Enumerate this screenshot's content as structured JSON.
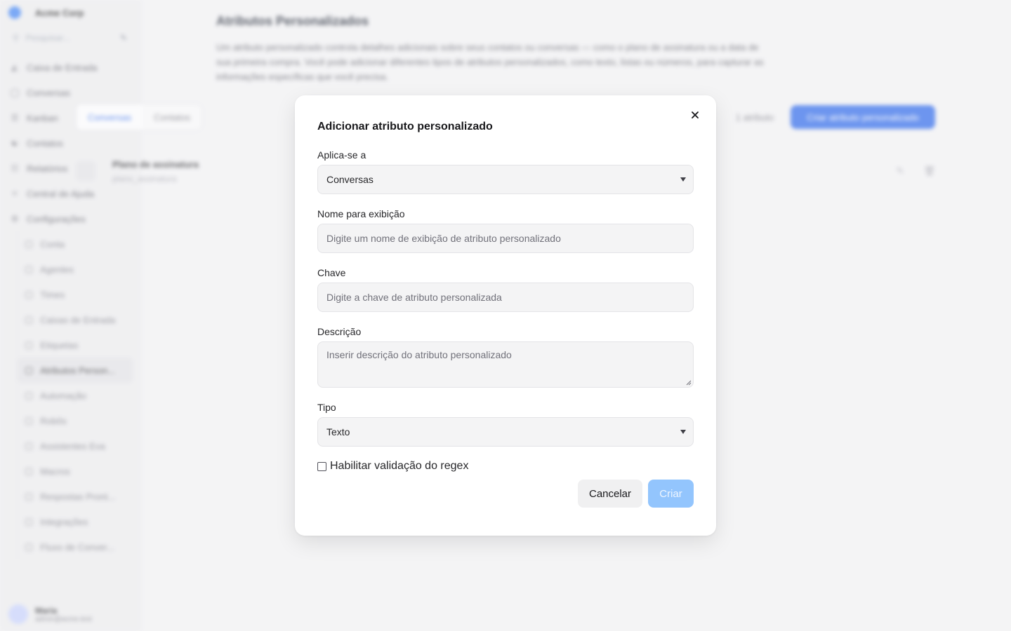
{
  "background": {
    "sidebar": {
      "brand": "Acme Corp",
      "search_placeholder": "Pesquisar...",
      "nav": [
        {
          "label": "Caixa de Entrada",
          "icon": "inbox-icon"
        },
        {
          "label": "Conversas",
          "icon": "chat-icon"
        },
        {
          "label": "Kanban",
          "icon": "kanban-icon"
        },
        {
          "label": "Contatos",
          "icon": "contacts-icon"
        },
        {
          "label": "Relatórios",
          "icon": "reports-icon"
        },
        {
          "label": "Central de Ajuda",
          "icon": "help-icon"
        },
        {
          "label": "Configurações",
          "icon": "settings-icon"
        }
      ],
      "sub_nav": [
        {
          "label": "Conta"
        },
        {
          "label": "Agentes"
        },
        {
          "label": "Times"
        },
        {
          "label": "Caixas de Entrada"
        },
        {
          "label": "Etiquetas"
        },
        {
          "label": "Atributos Person..."
        },
        {
          "label": "Automação"
        },
        {
          "label": "Robôs"
        },
        {
          "label": "Assistentes Eva"
        },
        {
          "label": "Macros"
        },
        {
          "label": "Respostas Pront..."
        },
        {
          "label": "Integrações"
        },
        {
          "label": "Fluxo de Conver..."
        }
      ],
      "user_name": "Maria",
      "user_email": "admin@acme.test"
    },
    "main": {
      "title": "Atributos Personalizados",
      "description": "Um atributo personalizado controla detalhes adicionais sobre seus contatos ou conversas — como o plano de assinatura ou a data de sua primeira compra. Você pode adicionar diferentes tipos de atributos personalizados, como texto, listas ou números, para capturar as informações específicas que você precisa.",
      "tabs": [
        "Conversas",
        "Contatos"
      ],
      "count": "1 atributo",
      "create_button": "Criar atributo personalizado",
      "row_name": "Plano de assinatura",
      "row_key": "plano_assinatura"
    }
  },
  "modal": {
    "title": "Adicionar atributo personalizado",
    "close_icon": "close-icon",
    "applies_to": {
      "label": "Aplica-se a",
      "value": "Conversas"
    },
    "display_name": {
      "label": "Nome para exibição",
      "placeholder": "Digite um nome de exibição de atributo personalizado"
    },
    "key": {
      "label": "Chave",
      "placeholder": "Digite a chave de atributo personalizada"
    },
    "description": {
      "label": "Descrição",
      "placeholder": "Inserir descrição do atributo personalizado"
    },
    "type": {
      "label": "Tipo",
      "value": "Texto"
    },
    "regex_checkbox": {
      "label": "Habilitar validação do regex",
      "checked": false
    },
    "cancel_label": "Cancelar",
    "create_label": "Criar",
    "colors": {
      "primary_disabled": "#93c5fd",
      "primary": "#2563eb"
    }
  }
}
